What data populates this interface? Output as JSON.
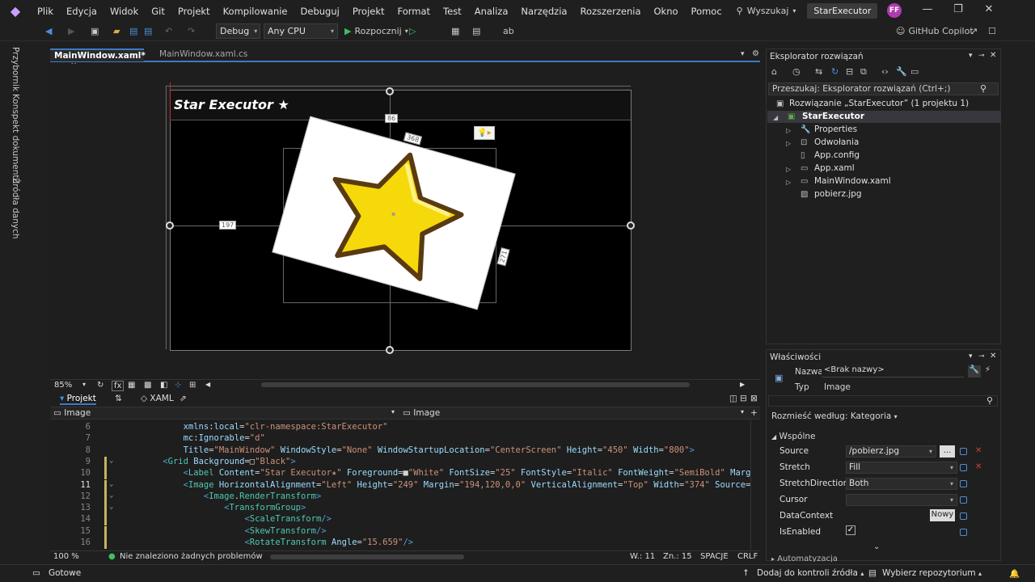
{
  "menu": {
    "items": [
      "Plik",
      "Edycja",
      "Widok",
      "Git",
      "Projekt",
      "Kompilowanie",
      "Debuguj",
      "Projekt",
      "Format",
      "Test",
      "Analiza",
      "Narzędzia",
      "Rozszerzenia",
      "Okno",
      "Pomoc"
    ],
    "search_label": "Wyszukaj",
    "solution_badge": "StarExecutor",
    "avatar_initials": "FF"
  },
  "toolbar": {
    "config": "Debug",
    "platform": "Any CPU",
    "start_label": "Rozpocznij",
    "copilot_label": "GitHub Copilot"
  },
  "left_tabs": [
    "Przybornik",
    "Konspekt dokumentu",
    "Źródła danych"
  ],
  "doc_tabs": {
    "active": "MainWindow.xaml*",
    "inactive": "MainWindow.xaml.cs"
  },
  "designer": {
    "window_title": "Star Executor ★",
    "dim_top": "86",
    "dim_width": "368",
    "dim_left": "197",
    "dim_height": "271",
    "accent": "#3c7ac6"
  },
  "zoom": {
    "level": "85%"
  },
  "switcher": {
    "project_label": "Projekt",
    "xaml_label": "XAML"
  },
  "code_nav": {
    "left": "Image",
    "right": "Image"
  },
  "code_lines": [
    {
      "n": "6",
      "cur": false,
      "fold": "",
      "chg": false,
      "indent": "        ",
      "tokens": [
        [
          "t-attr",
          "xmlns"
        ],
        [
          "t-plain",
          ":"
        ],
        [
          "t-attr",
          "local"
        ],
        [
          "t-plain",
          "="
        ],
        [
          "t-str",
          "\"clr-namespace:StarExecutor\""
        ]
      ]
    },
    {
      "n": "7",
      "cur": false,
      "fold": "",
      "chg": false,
      "indent": "        ",
      "tokens": [
        [
          "t-attr",
          "mc"
        ],
        [
          "t-plain",
          ":"
        ],
        [
          "t-attr",
          "Ignorable"
        ],
        [
          "t-plain",
          "="
        ],
        [
          "t-str",
          "\"d\""
        ]
      ]
    },
    {
      "n": "8",
      "cur": false,
      "fold": "",
      "chg": false,
      "indent": "        ",
      "tokens": [
        [
          "t-attr",
          "Title"
        ],
        [
          "t-plain",
          "="
        ],
        [
          "t-str",
          "\"MainWindow\""
        ],
        [
          "t-plain",
          " "
        ],
        [
          "t-attr",
          "WindowStyle"
        ],
        [
          "t-plain",
          "="
        ],
        [
          "t-str",
          "\"None\""
        ],
        [
          "t-plain",
          " "
        ],
        [
          "t-attr",
          "WindowStartupLocation"
        ],
        [
          "t-plain",
          "="
        ],
        [
          "t-str",
          "\"CenterScreen\""
        ],
        [
          "t-plain",
          " "
        ],
        [
          "t-attr",
          "Height"
        ],
        [
          "t-plain",
          "="
        ],
        [
          "t-str",
          "\"450\""
        ],
        [
          "t-plain",
          " "
        ],
        [
          "t-attr",
          "Width"
        ],
        [
          "t-plain",
          "="
        ],
        [
          "t-str",
          "\"800\""
        ],
        [
          "t-tag",
          ">"
        ]
      ]
    },
    {
      "n": "9",
      "cur": false,
      "fold": "⌄",
      "chg": true,
      "indent": "    ",
      "tokens": [
        [
          "t-tag",
          "<"
        ],
        [
          "t-el",
          "Grid"
        ],
        [
          "t-plain",
          " "
        ],
        [
          "t-attr",
          "Background"
        ],
        [
          "t-plain",
          "=□"
        ],
        [
          "t-str",
          "\"Black\""
        ],
        [
          "t-tag",
          ">"
        ]
      ]
    },
    {
      "n": "10",
      "cur": false,
      "fold": "",
      "chg": true,
      "indent": "        ",
      "tokens": [
        [
          "t-tag",
          "<"
        ],
        [
          "t-el",
          "Label"
        ],
        [
          "t-plain",
          " "
        ],
        [
          "t-attr",
          "Content"
        ],
        [
          "t-plain",
          "="
        ],
        [
          "t-str",
          "\"Star Executor★\""
        ],
        [
          "t-plain",
          " "
        ],
        [
          "t-attr",
          "Foreground"
        ],
        [
          "t-plain",
          "=■"
        ],
        [
          "t-str",
          "\"White\""
        ],
        [
          "t-plain",
          " "
        ],
        [
          "t-attr",
          "FontSize"
        ],
        [
          "t-plain",
          "="
        ],
        [
          "t-str",
          "\"25\""
        ],
        [
          "t-plain",
          " "
        ],
        [
          "t-attr",
          "FontStyle"
        ],
        [
          "t-plain",
          "="
        ],
        [
          "t-str",
          "\"Italic\""
        ],
        [
          "t-plain",
          " "
        ],
        [
          "t-attr",
          "FontWeight"
        ],
        [
          "t-plain",
          "="
        ],
        [
          "t-str",
          "\"SemiBold\""
        ],
        [
          "t-plain",
          " "
        ],
        [
          "t-attr",
          "Margin"
        ]
      ]
    },
    {
      "n": "11",
      "cur": true,
      "fold": "⌄",
      "chg": true,
      "indent": "        ",
      "tokens": [
        [
          "t-tag",
          "<"
        ],
        [
          "t-el",
          "Image"
        ],
        [
          "t-plain",
          " "
        ],
        [
          "t-attr",
          "HorizontalAlignment"
        ],
        [
          "t-plain",
          "="
        ],
        [
          "t-str",
          "\"Left\""
        ],
        [
          "t-plain",
          " "
        ],
        [
          "t-attr",
          "Height"
        ],
        [
          "t-plain",
          "="
        ],
        [
          "t-str",
          "\"249\""
        ],
        [
          "t-plain",
          " "
        ],
        [
          "t-attr",
          "Margin"
        ],
        [
          "t-plain",
          "="
        ],
        [
          "t-str",
          "\"194,120,0,0\""
        ],
        [
          "t-plain",
          " "
        ],
        [
          "t-attr",
          "VerticalAlignment"
        ],
        [
          "t-plain",
          "="
        ],
        [
          "t-str",
          "\"Top\""
        ],
        [
          "t-plain",
          " "
        ],
        [
          "t-attr",
          "Width"
        ],
        [
          "t-plain",
          "="
        ],
        [
          "t-str",
          "\"374\""
        ],
        [
          "t-plain",
          " "
        ],
        [
          "t-attr",
          "Source"
        ],
        [
          "t-plain",
          "="
        ],
        [
          "t-str",
          "\"/p"
        ]
      ]
    },
    {
      "n": "12",
      "cur": false,
      "fold": "⌄",
      "chg": true,
      "indent": "            ",
      "tokens": [
        [
          "t-tag",
          "<"
        ],
        [
          "t-el",
          "Image"
        ],
        [
          "t-plain",
          "."
        ],
        [
          "t-el",
          "RenderTransform"
        ],
        [
          "t-tag",
          ">"
        ]
      ]
    },
    {
      "n": "13",
      "cur": false,
      "fold": "⌄",
      "chg": true,
      "indent": "                ",
      "tokens": [
        [
          "t-tag",
          "<"
        ],
        [
          "t-el",
          "TransformGroup"
        ],
        [
          "t-tag",
          ">"
        ]
      ]
    },
    {
      "n": "14",
      "cur": false,
      "fold": "",
      "chg": true,
      "indent": "                    ",
      "tokens": [
        [
          "t-tag",
          "<"
        ],
        [
          "t-el",
          "ScaleTransform"
        ],
        [
          "t-tag",
          "/>"
        ]
      ]
    },
    {
      "n": "15",
      "cur": false,
      "fold": "",
      "chg": true,
      "indent": "                    ",
      "tokens": [
        [
          "t-tag",
          "<"
        ],
        [
          "t-el",
          "SkewTransform"
        ],
        [
          "t-tag",
          "/>"
        ]
      ]
    },
    {
      "n": "16",
      "cur": false,
      "fold": "",
      "chg": true,
      "indent": "                    ",
      "tokens": [
        [
          "t-tag",
          "<"
        ],
        [
          "t-el",
          "RotateTransform"
        ],
        [
          "t-plain",
          " "
        ],
        [
          "t-attr",
          "Angle"
        ],
        [
          "t-plain",
          "="
        ],
        [
          "t-str",
          "\"15.659\""
        ],
        [
          "t-tag",
          "/>"
        ]
      ]
    }
  ],
  "editor_status": {
    "zoom": "100 %",
    "problems": "Nie znaleziono żadnych problemów",
    "line": "W.: 11",
    "col": "Zn.: 15",
    "whitespace": "SPACJE",
    "eol": "CRLF"
  },
  "solution_explorer": {
    "title": "Eksplorator rozwiązań",
    "search_placeholder": "Przeszukaj: Eksplorator rozwiązań (Ctrl+;)",
    "items": [
      {
        "label": "Rozwiązanie „StarExecutor” (1 projektu 1)",
        "icon": "solution-icon"
      },
      {
        "label": "StarExecutor",
        "icon": "csharp-project-icon"
      },
      {
        "label": "Properties",
        "icon": "wrench-icon"
      },
      {
        "label": "Odwołania",
        "icon": "references-icon"
      },
      {
        "label": "App.config",
        "icon": "config-file-icon"
      },
      {
        "label": "App.xaml",
        "icon": "xaml-file-icon"
      },
      {
        "label": "MainWindow.xaml",
        "icon": "xaml-file-icon"
      },
      {
        "label": "pobierz.jpg",
        "icon": "image-file-icon"
      }
    ]
  },
  "properties": {
    "title": "Właściwości",
    "name_label": "Nazwa",
    "name_value": "<Brak nazwy>",
    "type_label": "Typ",
    "type_value": "Image",
    "arrange_label": "Rozmieść według: Kategoria",
    "section": "Wspólne",
    "rows": [
      {
        "name": "Source",
        "value": "/pobierz.jpg",
        "dropdown": true
      },
      {
        "name": "Stretch",
        "value": "Fill",
        "dropdown": true
      },
      {
        "name": "StretchDirection",
        "value": "Both",
        "dropdown": true
      },
      {
        "name": "Cursor",
        "value": "",
        "dropdown": true
      },
      {
        "name": "DataContext",
        "value": "",
        "dropdown": false
      },
      {
        "name": "IsEnabled",
        "value": "",
        "dropdown": false
      }
    ],
    "new_button": "Nowy",
    "browse_button": "...",
    "next_section": "Automatyzacja"
  },
  "statusbar": {
    "ready": "Gotowe",
    "add_to_source": "Dodaj do kontroli źródła",
    "select_repo": "Wybierz repozytorium"
  }
}
